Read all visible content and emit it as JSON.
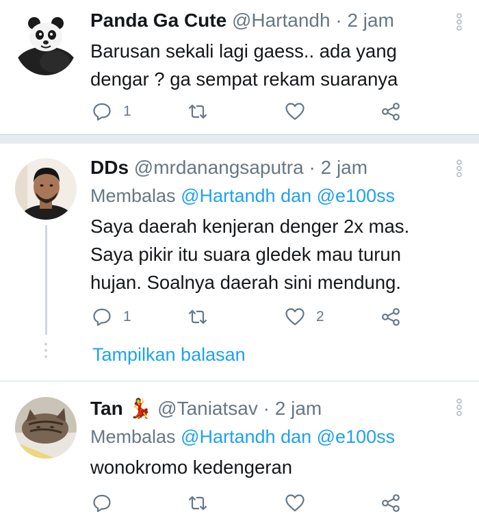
{
  "tweets": [
    {
      "name": "Panda Ga Cute",
      "emoji": "",
      "handle": "@Hartandh",
      "time": "· 2 jam",
      "replying_prefix": "",
      "replying_user1": "",
      "replying_and": "",
      "replying_user2": "",
      "text_lines": [
        "Barusan sekali lagi gaess.. ada yang",
        "dengar ? ga sempat rekam suaranya"
      ],
      "reply_count": "1",
      "retweet_count": "",
      "like_count": ""
    },
    {
      "name": "DDs",
      "emoji": "",
      "handle": "@mrdanangsaputra",
      "time": "· 2 jam",
      "replying_prefix": "Membalas",
      "replying_user1": "@Hartandh",
      "replying_and": "dan",
      "replying_user2": "@e100ss",
      "text_lines": [
        "Saya daerah kenjeran denger 2x mas.",
        "Saya pikir itu suara gledek mau turun",
        "hujan. Soalnya daerah sini mendung."
      ],
      "reply_count": "1",
      "retweet_count": "",
      "like_count": "2",
      "show_replies": "Tampilkan balasan"
    },
    {
      "name": "Tan",
      "emoji": "💃",
      "handle": "@Taniatsav",
      "time": "· 2 jam",
      "replying_prefix": "Membalas",
      "replying_user1": "@Hartandh",
      "replying_and": "dan",
      "replying_user2": "@e100ss",
      "text_lines": [
        "wonokromo kedengeran"
      ],
      "reply_count": "",
      "retweet_count": "",
      "like_count": ""
    }
  ],
  "icons": {
    "reply": "reply-icon",
    "retweet": "retweet-icon",
    "like": "heart-icon",
    "share": "share-icon",
    "more": "more-vertical-icon"
  },
  "colors": {
    "link": "#1da1f2",
    "secondary_text": "#657786",
    "divider": "#e6ecf0"
  }
}
